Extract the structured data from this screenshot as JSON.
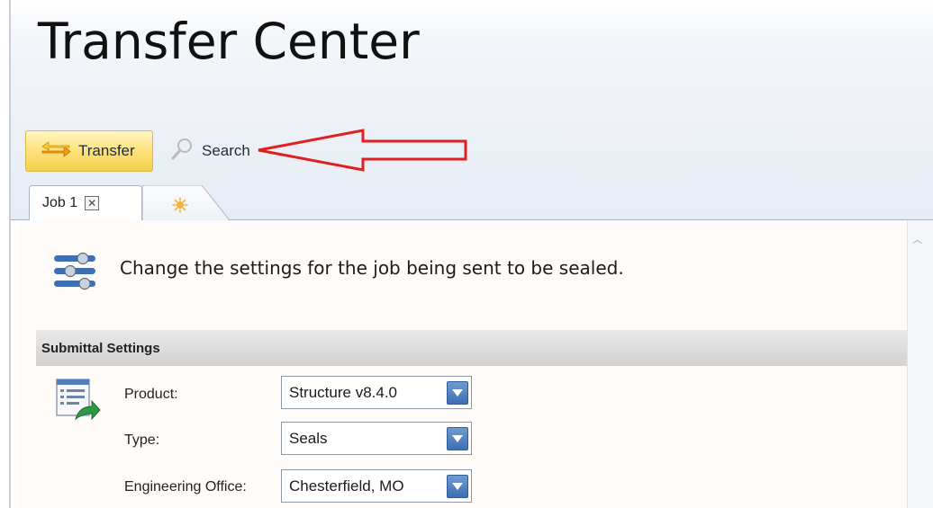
{
  "title": "Transfer Center",
  "toolbar": {
    "transfer_label": "Transfer",
    "search_label": "Search"
  },
  "tabs": [
    {
      "label": "Job 1",
      "close_glyph": "☒"
    },
    {
      "icon": "new-tab-sparkle-icon"
    }
  ],
  "content": {
    "description": "Change the settings for the job being sent to be sealed.",
    "section_title": "Submittal Settings",
    "fields": [
      {
        "label": "Product:",
        "value": "Structure v8.4.0"
      },
      {
        "label": "Type:",
        "value": "Seals"
      },
      {
        "label": "Engineering Office:",
        "value": "Chesterfield, MO"
      }
    ]
  },
  "colors": {
    "accent_button": "#fde27a",
    "annotation_arrow": "#e02020",
    "dropdown_button": "#3d6fb2"
  }
}
